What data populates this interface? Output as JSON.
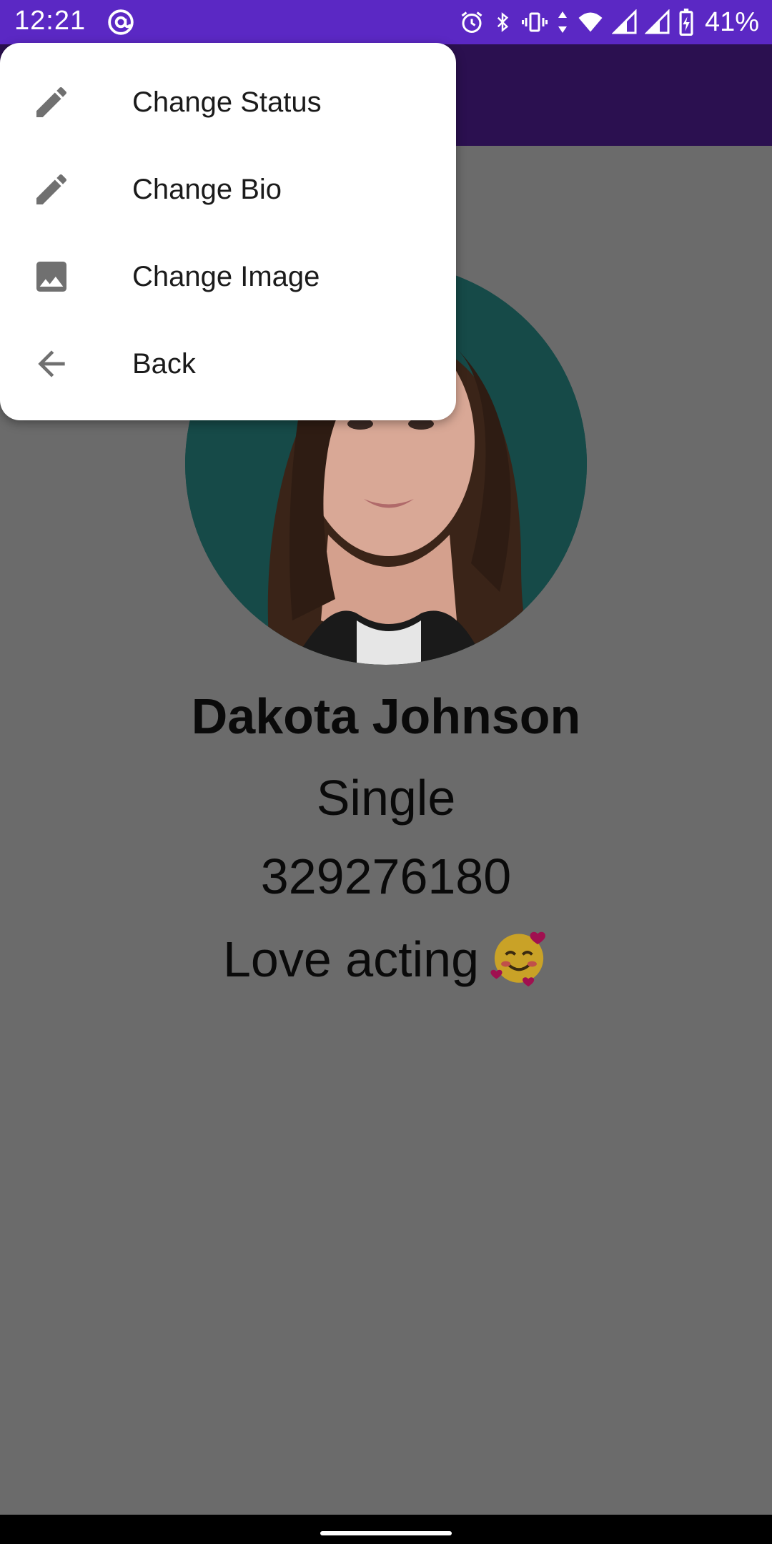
{
  "status_bar": {
    "time": "12:21",
    "battery_percent": "41%",
    "icons": [
      "at-sign-icon",
      "alarm-icon",
      "bluetooth-icon",
      "vibrate-icon",
      "wifi-icon",
      "signal-icon",
      "signal-icon",
      "battery-icon"
    ]
  },
  "menu": {
    "items": [
      {
        "label": "Change Status",
        "icon": "pencil-icon"
      },
      {
        "label": "Change Bio",
        "icon": "pencil-icon"
      },
      {
        "label": "Change Image",
        "icon": "image-icon"
      },
      {
        "label": "Back",
        "icon": "arrow-back-icon"
      }
    ]
  },
  "profile": {
    "name": "Dakota Johnson",
    "status": "Single",
    "phone": "329276180",
    "bio": "Love acting",
    "bio_emoji": "smiling-face-with-hearts"
  },
  "colors": {
    "status_bar": "#5b28c4",
    "toolbar_dimmed": "#2b1050",
    "scrim_background": "#6b6b6b",
    "menu_background": "#ffffff",
    "avatar_background": "#164a48"
  }
}
